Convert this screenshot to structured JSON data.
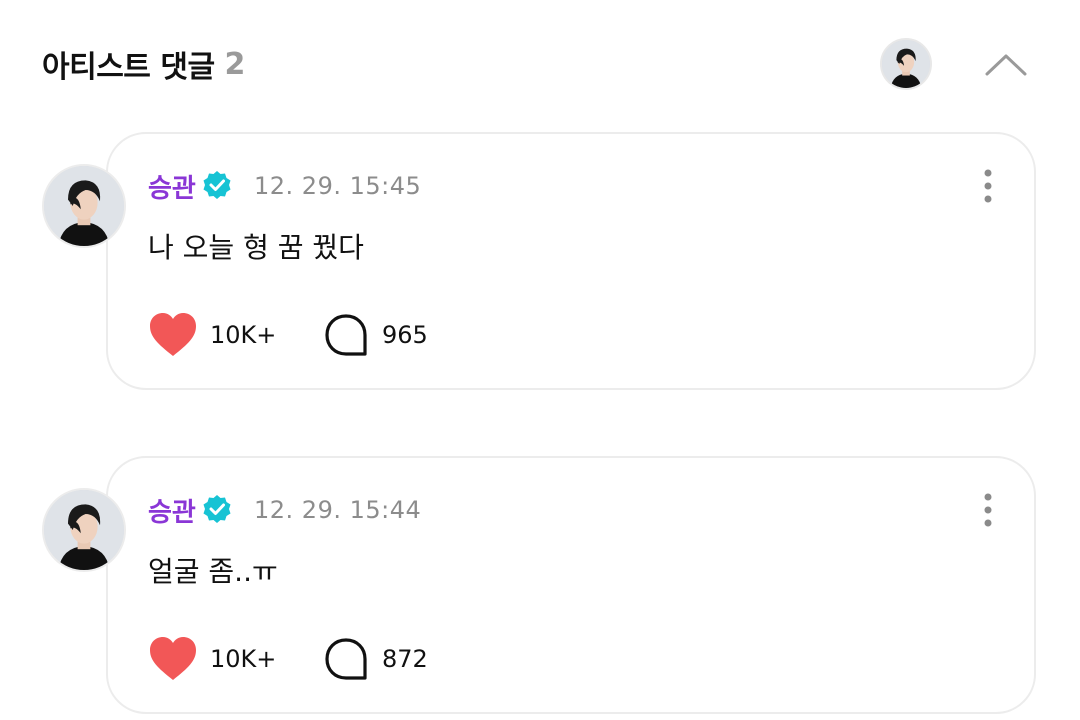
{
  "header": {
    "title": "아티스트 댓글",
    "count": "2",
    "collapse_icon": "chevron-up-icon"
  },
  "colors": {
    "author": "#8a36d6",
    "verified": "#17c3d4",
    "like": "#f25757",
    "timestamp": "#8c8c8c"
  },
  "comments": [
    {
      "author": "승관",
      "timestamp": "12. 29. 15:45",
      "text": "나 오늘 형 꿈 꿨다",
      "likes": "10K+",
      "replies": "965"
    },
    {
      "author": "승관",
      "timestamp": "12. 29. 15:44",
      "text": "얼굴 좀..ㅠ",
      "likes": "10K+",
      "replies": "872"
    }
  ]
}
